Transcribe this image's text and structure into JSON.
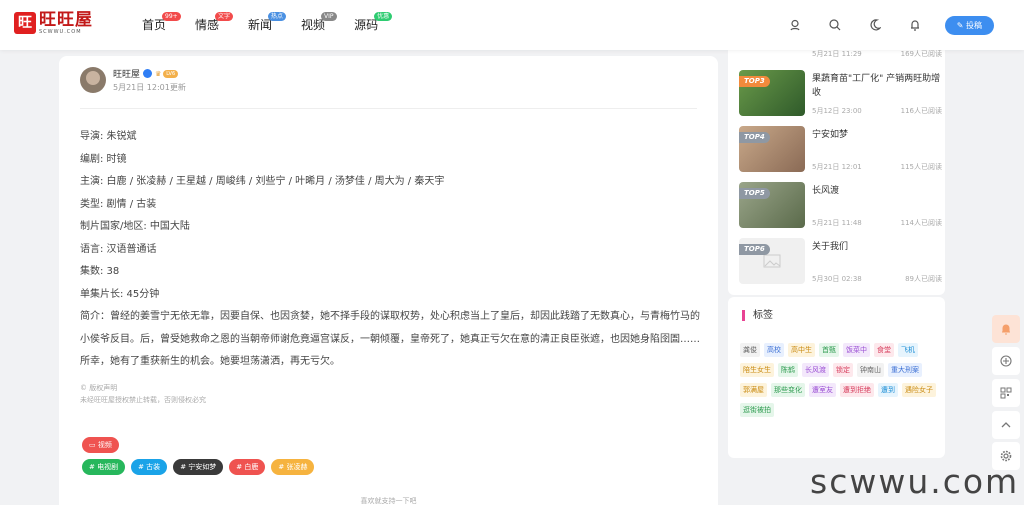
{
  "brand": {
    "logo_char": "旺",
    "name": "旺旺屋",
    "domain": "SCWWU.COM"
  },
  "nav": [
    {
      "label": "首页",
      "badge": "99+",
      "badge_color": "#f24b4b"
    },
    {
      "label": "情感",
      "badge": "文字",
      "badge_color": "#f24b4b"
    },
    {
      "label": "新闻",
      "badge": "热点",
      "badge_color": "#4a90e2"
    },
    {
      "label": "视频",
      "badge": "VIP",
      "badge_color": "#888888"
    },
    {
      "label": "源码",
      "badge": "优惠",
      "badge_color": "#2ecc71"
    }
  ],
  "header_icons": [
    "user-icon",
    "search-icon",
    "moon-icon",
    "bell-icon"
  ],
  "post_button": "投稿",
  "author": {
    "name": "旺旺屋",
    "level": "LV6",
    "time": "5月21日 12:01更新"
  },
  "details": [
    "导演: 朱锐斌",
    "编剧: 时镜",
    "主演: 白鹿 / 张凌赫 / 王星越 / 周峻纬 / 刘些宁 / 叶晞月 / 汤梦佳 / 周大为 / 秦天宇",
    "类型: 剧情 / 古装",
    "制片国家/地区: 中国大陆",
    "语言: 汉语普通话",
    "集数: 38",
    "单集片长: 45分钟"
  ],
  "intro": "简介：曾经的姜雪宁无依无靠，因要自保、也因贪婪，她不择手段的谋取权势，处心积虑当上了皇后，却因此践踏了无数真心，与青梅竹马的小侯爷反目。后，曾受她救命之恩的当朝帝师谢危竟逼宫谋反，一朝倾覆，皇帝死了，她真正亏欠在意的清正良臣张遮，也因她身陷囹圄……所幸，她有了重获新生的机会。她要坦荡潇洒，再无亏欠。",
  "copyright": {
    "title": "© 版权声明",
    "text": "未经旺旺屋授权禁止转载，否则侵权必究"
  },
  "category_tag": "视频",
  "post_tags": [
    {
      "label": "# 电视剧",
      "color": "#27b75c"
    },
    {
      "label": "# 古装",
      "color": "#1aa3e8"
    },
    {
      "label": "# 宁安如梦",
      "color": "#3a3a3a"
    },
    {
      "label": "# 白鹿",
      "color": "#ef5350"
    },
    {
      "label": "# 张凌赫",
      "color": "#f6b33f"
    }
  ],
  "likes_text": "喜欢就支持一下吧",
  "ranking": [
    {
      "badge": "",
      "title": "",
      "time": "5月21日 11:29",
      "views": "169人已阅读",
      "partial": true
    },
    {
      "badge": "TOP3",
      "title": "果蔬育苗\"工厂化\" 产销两旺助增收",
      "time": "5月12日 23:00",
      "views": "116人已阅读"
    },
    {
      "badge": "TOP4",
      "title": "宁安如梦",
      "time": "5月21日 12:01",
      "views": "115人已阅读"
    },
    {
      "badge": "TOP5",
      "title": "长风渡",
      "time": "5月21日 11:48",
      "views": "114人已阅读"
    },
    {
      "badge": "TOP6",
      "title": "关于我们",
      "time": "5月30日 02:38",
      "views": "89人已阅读"
    }
  ],
  "tags_title": "标签",
  "sidebar_tags": [
    {
      "label": "龚俊",
      "bg": "#f2f2f2",
      "fg": "#666666"
    },
    {
      "label": "高校",
      "bg": "#e8f0fe",
      "fg": "#3b6fd4"
    },
    {
      "label": "高中生",
      "bg": "#fdf3dc",
      "fg": "#c98a0f"
    },
    {
      "label": "首甄",
      "bg": "#e5f6ea",
      "fg": "#2d9b4f"
    },
    {
      "label": "饭菜中",
      "bg": "#f3e8fb",
      "fg": "#9b4fd4"
    },
    {
      "label": "食堂",
      "bg": "#fde8ec",
      "fg": "#d63a5a"
    },
    {
      "label": "飞机",
      "bg": "#e6f4fd",
      "fg": "#1f8fd6"
    },
    {
      "label": "陪生女生",
      "bg": "#fdf3dc",
      "fg": "#c98a0f"
    },
    {
      "label": "陈鹤",
      "bg": "#e5f6ea",
      "fg": "#2d9b4f"
    },
    {
      "label": "长风渡",
      "bg": "#f3e8fb",
      "fg": "#9b4fd4"
    },
    {
      "label": "锁定",
      "bg": "#fde8ec",
      "fg": "#d63a5a"
    },
    {
      "label": "钟南山",
      "bg": "#f2f2f2",
      "fg": "#666666"
    },
    {
      "label": "重大刑案",
      "bg": "#e8f0fe",
      "fg": "#3b6fd4"
    },
    {
      "label": "郭满屋",
      "bg": "#fdf3dc",
      "fg": "#c98a0f"
    },
    {
      "label": "那些变化",
      "bg": "#e5f6ea",
      "fg": "#2d9b4f"
    },
    {
      "label": "遭室友",
      "bg": "#f3e8fb",
      "fg": "#9b4fd4"
    },
    {
      "label": "遭到拒绝",
      "bg": "#fde8ec",
      "fg": "#d63a5a"
    },
    {
      "label": "遭到",
      "bg": "#e6f4fd",
      "fg": "#1f8fd6"
    },
    {
      "label": "遇险女子",
      "bg": "#fdf3dc",
      "fg": "#c98a0f"
    },
    {
      "label": "逛街被拍",
      "bg": "#e5f6ea",
      "fg": "#2d9b4f"
    }
  ],
  "float_buttons": [
    "bell-icon",
    "plus-circle-icon",
    "qrcode-icon",
    "arrow-up-icon",
    "gear-icon"
  ],
  "watermark": "scwwu.com"
}
